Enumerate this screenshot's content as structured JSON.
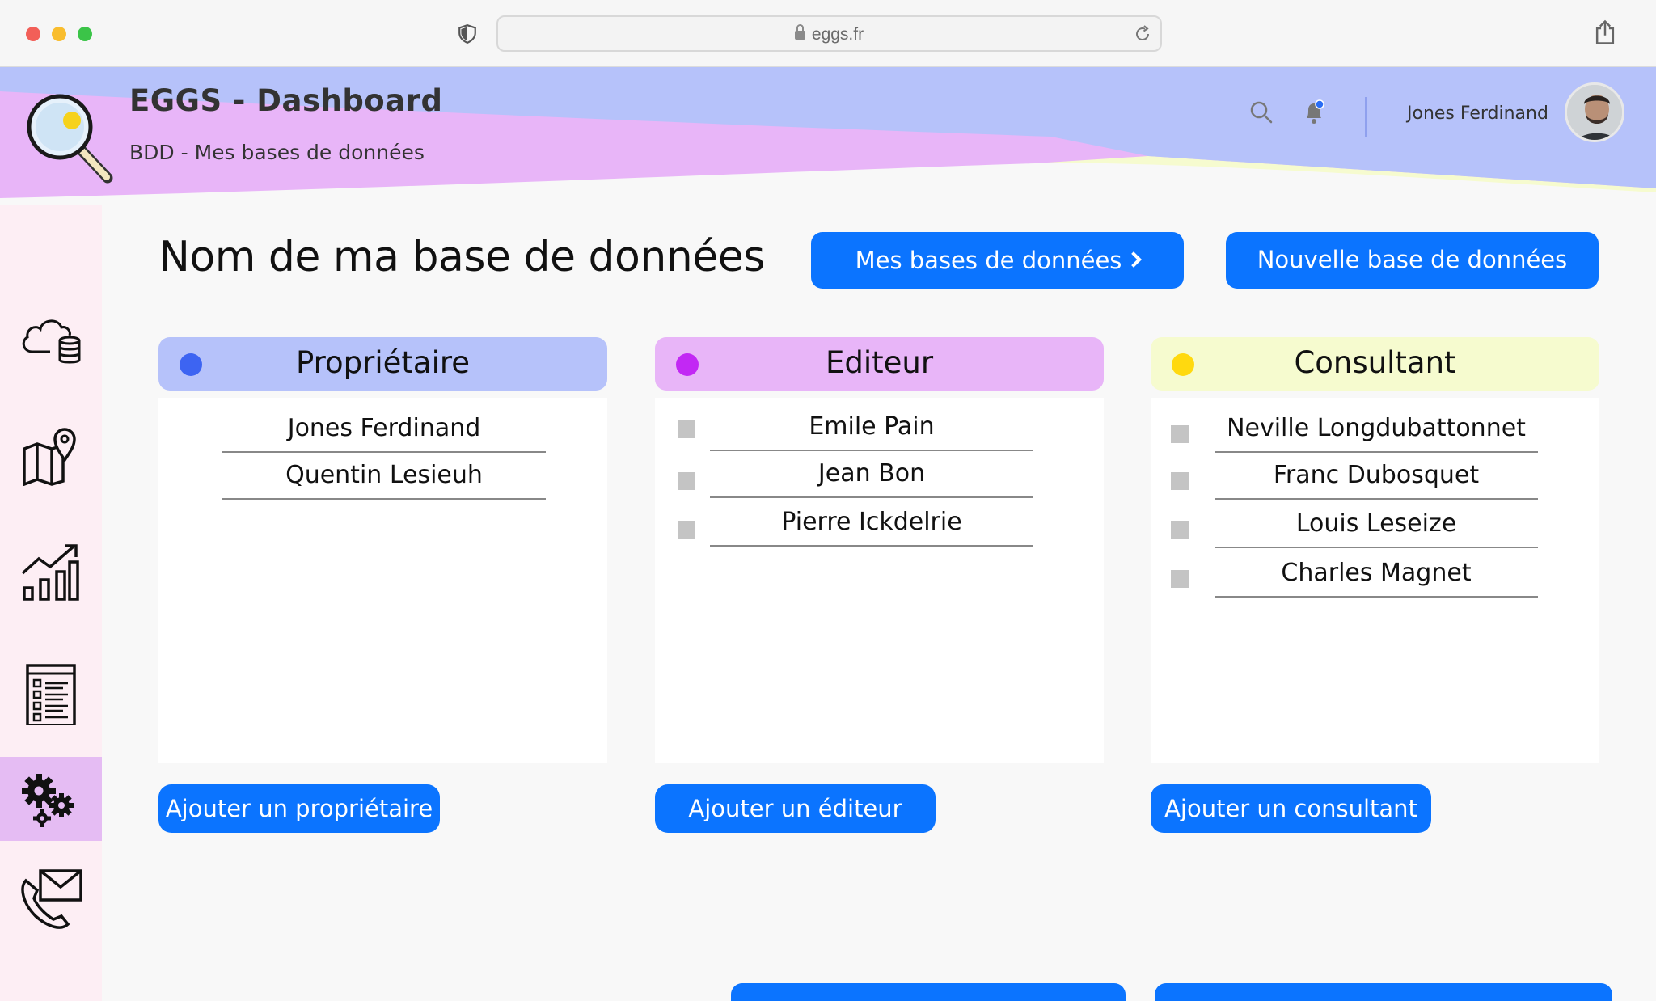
{
  "browser": {
    "url": "eggs.fr"
  },
  "header": {
    "title": "EGGS - Dashboard",
    "subtitle": "BDD - Mes bases de données",
    "user_name": "Jones Ferdinand",
    "colors": {
      "blue": "#b6c2fa",
      "pink": "#e8b5f8",
      "yellow": "#f6fbcf"
    }
  },
  "sidebar": {
    "items": [
      {
        "icon": "cloud-database-icon"
      },
      {
        "icon": "map-pin-icon"
      },
      {
        "icon": "chart-growth-icon"
      },
      {
        "icon": "checklist-icon"
      },
      {
        "icon": "gears-icon",
        "active": true
      },
      {
        "icon": "phone-mail-icon"
      }
    ]
  },
  "main": {
    "page_title": "Nom de ma base de données",
    "my_databases_button": "Mes bases de données",
    "new_database_button": "Nouvelle base de données"
  },
  "panels": {
    "owner": {
      "title": "Propriétaire",
      "dot_color": "#3d64f2",
      "header_color": "#b6c2fa",
      "people": [
        "Jones Ferdinand",
        "Quentin Lesieuh"
      ],
      "add_button": "Ajouter un propriétaire"
    },
    "editor": {
      "title": "Editeur",
      "dot_color": "#c228f4",
      "header_color": "#e8b5f8",
      "people": [
        "Emile Pain",
        "Jean Bon",
        "Pierre Ickdelrie"
      ],
      "add_button": "Ajouter un éditeur"
    },
    "consultant": {
      "title": "Consultant",
      "dot_color": "#ffd90f",
      "header_color": "#f6fbcf",
      "people": [
        "Neville Longdubattonnet",
        "Franc Dubosquet",
        "Louis Leseize",
        "Charles Magnet"
      ],
      "add_button": "Ajouter un consultant"
    }
  },
  "accent_color": "#0b74ff"
}
